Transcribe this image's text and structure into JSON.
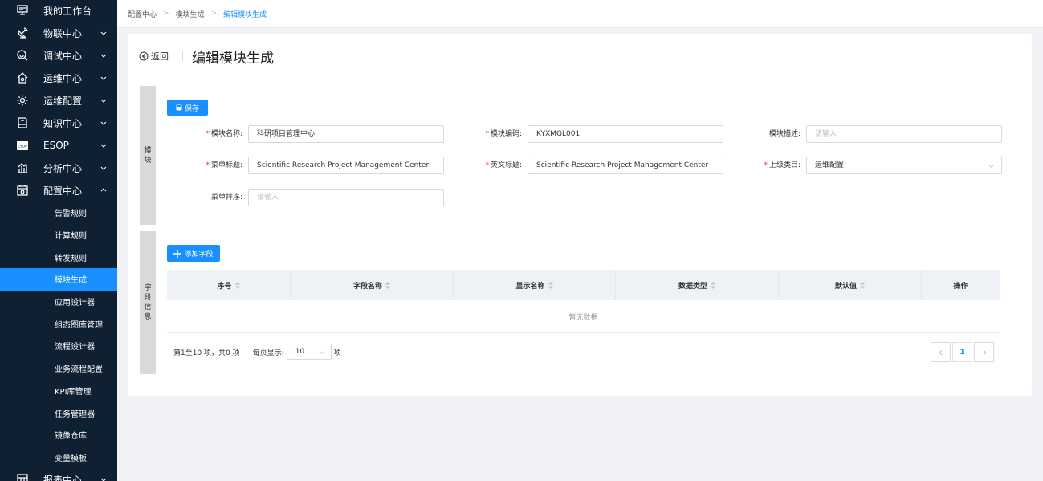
{
  "sidebar": {
    "items": [
      {
        "label": "我的工作台",
        "icon": "monitor-icon",
        "expandable": false
      },
      {
        "label": "物联中心",
        "icon": "satellite-dish-icon",
        "expandable": true
      },
      {
        "label": "调试中心",
        "icon": "debug-search-icon",
        "expandable": true
      },
      {
        "label": "运维中心",
        "icon": "house-ops-icon",
        "expandable": true
      },
      {
        "label": "运维配置",
        "icon": "gear-icon",
        "expandable": true
      },
      {
        "label": "知识中心",
        "icon": "knowledge-book-icon",
        "expandable": true
      },
      {
        "label": "ESOP",
        "icon": "esop-icon",
        "expandable": true
      },
      {
        "label": "分析中心",
        "icon": "analysis-chart-icon",
        "expandable": true
      },
      {
        "label": "配置中心",
        "icon": "config-box-icon",
        "expandable": true,
        "expanded": true
      }
    ],
    "sub_items": [
      "告警规则",
      "计算规则",
      "转发规则",
      "模块生成",
      "应用设计器",
      "组态图库管理",
      "流程设计器",
      "业务流程配置",
      "KPI库管理",
      "任务管理器",
      "镜像仓库",
      "变量模板"
    ],
    "active_sub": "模块生成",
    "bottom_item": {
      "label": "报表中心",
      "icon": "report-icon"
    },
    "esop_icon_text": "ESOP"
  },
  "breadcrumb": [
    "配置中心",
    "模块生成",
    "编辑模块生成"
  ],
  "header": {
    "back_label": "返回",
    "title": "编辑模块生成"
  },
  "module_section": {
    "side_label": [
      "模",
      "块"
    ],
    "save_label": "保存",
    "fields": {
      "module_name": {
        "label": "模块名称:",
        "value": "科研项目管理中心",
        "required": true
      },
      "module_code": {
        "label": "模块编码:",
        "value": "KYXMGL001",
        "required": true
      },
      "module_desc": {
        "label": "模块描述:",
        "placeholder": "请输入",
        "required": false
      },
      "menu_title": {
        "label": "菜单标题:",
        "value": "Scientific Research Project Management Center",
        "required": true
      },
      "english_title": {
        "label": "英文标题:",
        "value": "Scientific Research Project Management Center",
        "required": true
      },
      "parent_category": {
        "label": "上级类目:",
        "value": "运维配置",
        "required": true
      },
      "menu_order": {
        "label": "菜单排序:",
        "placeholder": "请输入",
        "required": false
      }
    }
  },
  "fields_section": {
    "side_label": [
      "字",
      "段",
      "信",
      "息"
    ],
    "add_label": "添加字段",
    "columns": [
      {
        "label": "序号",
        "sortable": true
      },
      {
        "label": "字段名称",
        "sortable": true
      },
      {
        "label": "显示名称",
        "sortable": true
      },
      {
        "label": "数据类型",
        "sortable": true
      },
      {
        "label": "默认值",
        "sortable": true
      },
      {
        "label": "操作",
        "sortable": false
      }
    ],
    "empty_text": "暂无数据",
    "pagination": {
      "summary": "第1至10 项，共0 项",
      "page_size_label": "每页显示:",
      "page_size": "10",
      "page_size_suffix": "项",
      "current_page": "1"
    }
  },
  "colors": {
    "primary": "#1890ff",
    "sidebar_bg": "#0f2033",
    "required": "#f5222d"
  }
}
